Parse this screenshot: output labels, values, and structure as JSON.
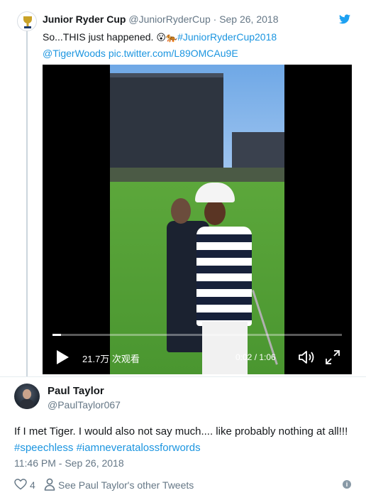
{
  "quoted_tweet": {
    "author_name": "Junior Ryder Cup",
    "author_handle": "@JuniorRyderCup",
    "separator": "·",
    "date": "Sep 26, 2018",
    "text_line1_prefix": "So...THIS just happened.",
    "emoji_1": "😮",
    "emoji_2": "🐅",
    "hashtag": "#JuniorRyderCup2018",
    "mention": "@TigerWoods",
    "media_link": "pic.twitter.com/L89OMCAu9E",
    "avatar_icon": "ryder-cup-logo-icon"
  },
  "video": {
    "views": "21.7万 次观看",
    "timecode": "0:02 / 1:06",
    "progress": 0.03,
    "play_icon": "play-icon",
    "volume_icon": "volume-icon",
    "fullscreen_icon": "fullscreen-icon"
  },
  "tweet": {
    "author_name": "Paul Taylor",
    "author_handle": "@PaulTaylor067",
    "text_prefix": "If I met Tiger. I would also not say much.... like probably nothing at all!!! ",
    "hashtag_1": "#speechless",
    "hashtag_2": "#iamneveratalossforwords",
    "timestamp": "11:46 PM - Sep 26, 2018",
    "like_count": "4",
    "other_tweets_link": "See Paul Taylor's other Tweets"
  },
  "colors": {
    "link": "#1b95e0",
    "secondary_text": "#657786",
    "twitter_blue": "#1da1f2"
  }
}
